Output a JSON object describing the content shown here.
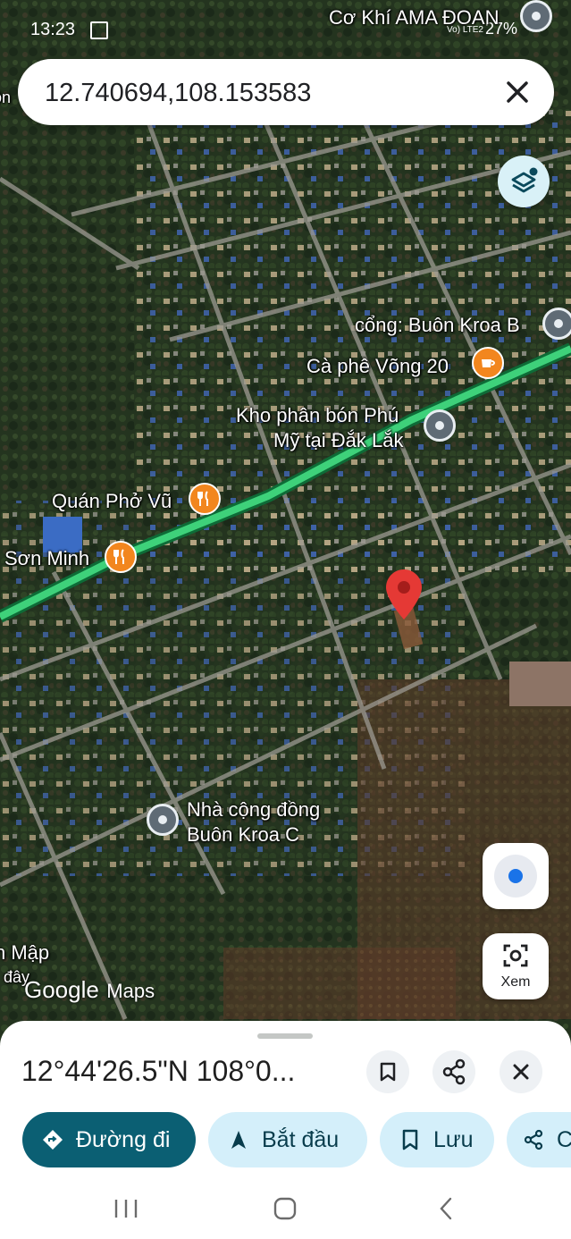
{
  "status_bar": {
    "time": "13:23",
    "battery": "27%",
    "network": "Vo) LTE2"
  },
  "search": {
    "value": "12.740694,108.153583"
  },
  "map": {
    "labels": {
      "co_khi": "Cơ Khí AMA ĐOAN",
      "cong_buon_kroa_b": "cổng: Buôn Kroa B",
      "ca_phe": "Cà phê Võng 20",
      "kho_phan_bon_1": "Kho phân bón Phú",
      "kho_phan_bon_2": "Mỹ tại Đắk Lắk",
      "quan_pho": "Quán Phở Vũ",
      "son_minh": "Sơn Minh",
      "nha_cong_dong_1": "Nhà cộng đồng",
      "nha_cong_dong_2": "Buôn Kroa C",
      "map_1": "n Mập",
      "map_2": "đây",
      "left_edge": "ôn"
    },
    "attribution": {
      "google": "Google",
      "maps": "Maps"
    },
    "lens_label": "Xem",
    "road_color": "#3ed17a",
    "pin_color": "#e53935"
  },
  "sheet": {
    "title": "12°44'26.5\"N 108°0...",
    "actions": {
      "directions": "Đường đi",
      "start": "Bắt đầu",
      "save": "Lưu",
      "share_partial": "C"
    }
  }
}
